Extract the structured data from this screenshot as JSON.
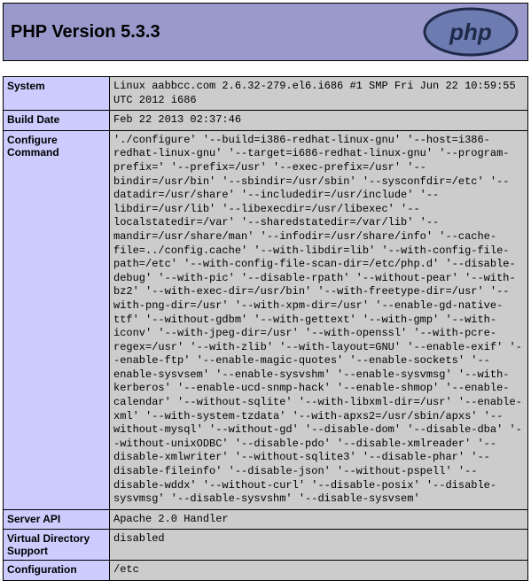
{
  "title": "PHP Version 5.3.3",
  "logo_text": "php",
  "rows": [
    {
      "label": "System",
      "value": "Linux aabbcc.com 2.6.32-279.el6.i686 #1 SMP Fri Jun 22 10:59:55 UTC 2012 i686"
    },
    {
      "label": "Build Date",
      "value": "Feb 22 2013 02:37:46"
    },
    {
      "label": "Configure Command",
      "value": "'./configure' '--build=i386-redhat-linux-gnu' '--host=i386-redhat-linux-gnu' '--target=i686-redhat-linux-gnu' '--program-prefix=' '--prefix=/usr' '--exec-prefix=/usr' '--bindir=/usr/bin' '--sbindir=/usr/sbin' '--sysconfdir=/etc' '--datadir=/usr/share' '--includedir=/usr/include' '--libdir=/usr/lib' '--libexecdir=/usr/libexec' '--localstatedir=/var' '--sharedstatedir=/var/lib' '--mandir=/usr/share/man' '--infodir=/usr/share/info' '--cache-file=../config.cache' '--with-libdir=lib' '--with-config-file-path=/etc' '--with-config-file-scan-dir=/etc/php.d' '--disable-debug' '--with-pic' '--disable-rpath' '--without-pear' '--with-bz2' '--with-exec-dir=/usr/bin' '--with-freetype-dir=/usr' '--with-png-dir=/usr' '--with-xpm-dir=/usr' '--enable-gd-native-ttf' '--without-gdbm' '--with-gettext' '--with-gmp' '--with-iconv' '--with-jpeg-dir=/usr' '--with-openssl' '--with-pcre-regex=/usr' '--with-zlib' '--with-layout=GNU' '--enable-exif' '--enable-ftp' '--enable-magic-quotes' '--enable-sockets' '--enable-sysvsem' '--enable-sysvshm' '--enable-sysvmsg' '--with-kerberos' '--enable-ucd-snmp-hack' '--enable-shmop' '--enable-calendar' '--without-sqlite' '--with-libxml-dir=/usr' '--enable-xml' '--with-system-tzdata' '--with-apxs2=/usr/sbin/apxs' '--without-mysql' '--without-gd' '--disable-dom' '--disable-dba' '--without-unixODBC' '--disable-pdo' '--disable-xmlreader' '--disable-xmlwriter' '--without-sqlite3' '--disable-phar' '--disable-fileinfo' '--disable-json' '--without-pspell' '--disable-wddx' '--without-curl' '--disable-posix' '--disable-sysvmsg' '--disable-sysvshm' '--disable-sysvsem'"
    },
    {
      "label": "Server API",
      "value": "Apache 2.0 Handler"
    },
    {
      "label": "Virtual Directory Support",
      "value": "disabled"
    },
    {
      "label": "Configuration",
      "value": "/etc"
    }
  ]
}
